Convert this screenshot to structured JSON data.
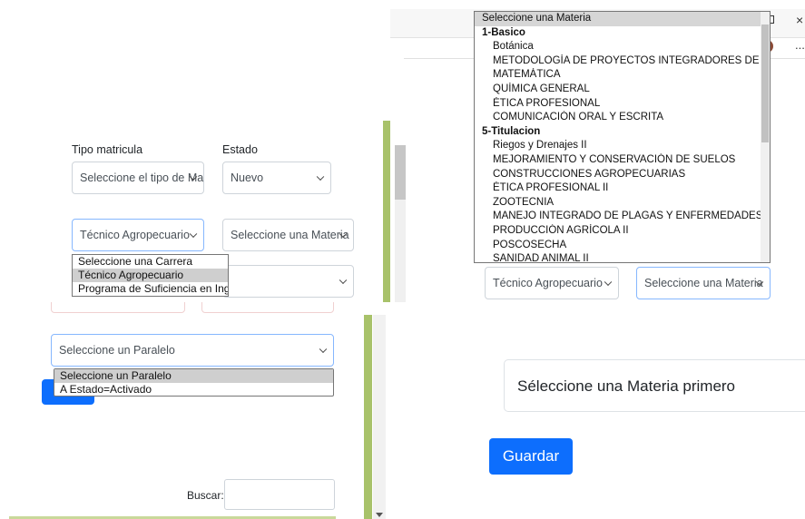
{
  "panel_a": {
    "tipo_label": "Tipo matricula",
    "tipo_select": "Seleccione el tipo de Ma",
    "estado_label": "Estado",
    "estado_select": "Nuevo",
    "carrera_select": "Técnico Agropecuario",
    "materia_select": "Seleccione una Materia",
    "carrera_options": [
      "Seleccione una Carrera",
      "Técnico Agropecuario",
      "Programa de Suficiencia en Ingles"
    ],
    "carrera_highlighted": "Técnico Agropecuario"
  },
  "panel_b": {
    "list_header": "Seleccione una Materia",
    "groups": [
      {
        "name": "1-Basico",
        "items": [
          "Botánica",
          "METODOLOGÍA DE PROYECTOS INTEGRADORES DE SABERE",
          "MATEMÁTICA",
          "QUÍMICA GENERAL",
          "ÉTICA PROFESIONAL",
          "COMUNICACIÓN ORAL Y ESCRITA"
        ]
      },
      {
        "name": "5-Titulacion",
        "items": [
          "Riegos y Drenajes II",
          "MEJORAMIENTO Y CONSERVACIÓN DE SUELOS",
          "CONSTRUCCIONES AGROPECUARIAS",
          "ÉTICA PROFESIONAL II",
          "ZOOTECNIA",
          "MANEJO INTEGRADO DE PLAGAS Y ENFERMEDADES",
          "PRODUCCIÓN AGRÍCOLA II",
          "POSCOSECHA",
          "SANIDAD ANIMAL II"
        ]
      }
    ],
    "carrera_select": "Técnico Agropecuario",
    "materia_select": "Seleccione una Materia",
    "window_close": "×",
    "window_more": "..."
  },
  "panel_c": {
    "paralelo_select": "Seleccione un Paralelo",
    "paralelo_options": [
      "Seleccione un Paralelo",
      "A Estado=Activado"
    ],
    "paralelo_highlighted": "Seleccione un Paralelo",
    "buscar_label": "Buscar:",
    "buscar_value": ""
  },
  "panel_d": {
    "materia_field": "Séleccione una Materia primero",
    "save_button": "Guardar"
  },
  "colors": {
    "primary": "#0d6efd",
    "green_bar": "#a8c26a",
    "highlight": "#cfcfcf"
  }
}
